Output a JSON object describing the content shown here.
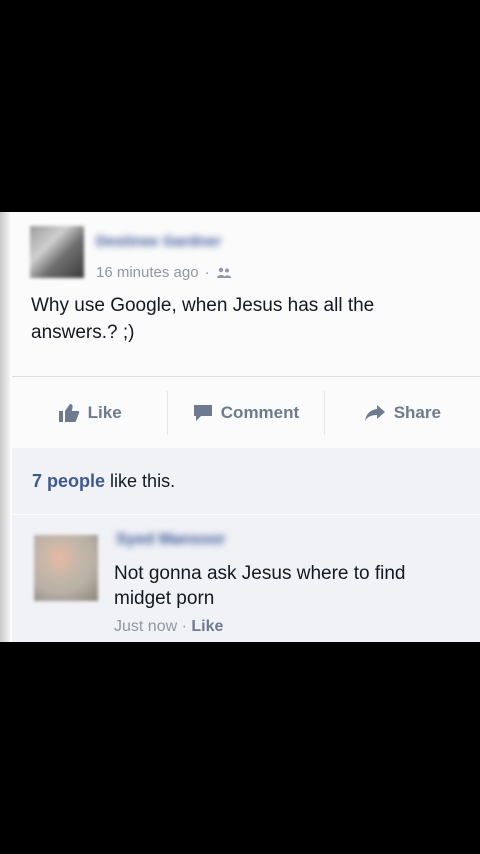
{
  "post": {
    "author": "Destinee Gardner",
    "timestamp": "16 minutes ago",
    "separator": "·",
    "audience_icon": "friends-icon",
    "text": "Why use Google, when Jesus has all the answers.? ;)"
  },
  "actions": {
    "like_label": "Like",
    "comment_label": "Comment",
    "share_label": "Share"
  },
  "likes": {
    "count_label": "7 people",
    "suffix": "like this."
  },
  "comment": {
    "author": "Syed Mansoor",
    "text": "Not gonna ask Jesus where to find midget porn",
    "timestamp": "Just now",
    "separator": "·",
    "like_label": "Like"
  },
  "colors": {
    "link_blue": "#3b5998",
    "meta_gray": "#9197a3",
    "action_gray": "#6d7b91",
    "text_dark": "#141823"
  }
}
